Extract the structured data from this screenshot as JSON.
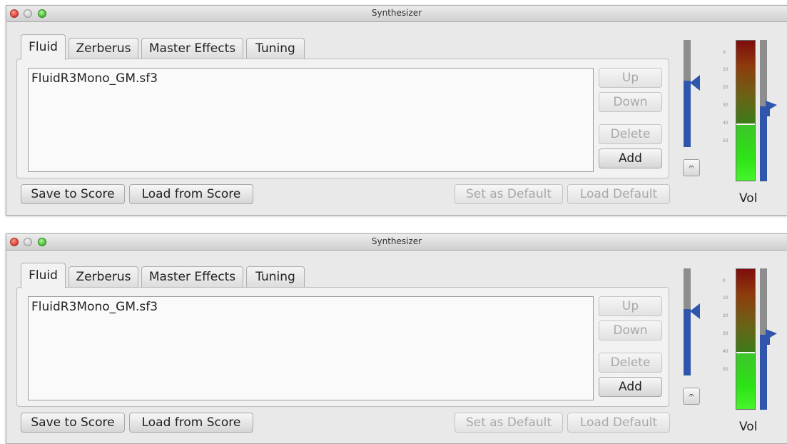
{
  "windows": [
    {
      "title": "Synthesizer",
      "tabs": [
        "Fluid",
        "Zerberus",
        "Master Effects",
        "Tuning"
      ],
      "active_tab": "Fluid",
      "soundfonts": [
        "FluidR3Mono_GM.sf3"
      ],
      "side_buttons": {
        "up": "Up",
        "down": "Down",
        "delete": "Delete",
        "add": "Add"
      },
      "bottom_buttons": {
        "save_to_score": "Save to Score",
        "load_from_score": "Load from Score",
        "set_as_default": "Set as Default",
        "load_default": "Load Default"
      },
      "gain_level": 0.62,
      "meter_level": 0.4,
      "volume_level": 0.53,
      "meter_scale": [
        "0",
        "10",
        "20",
        "30",
        "40",
        "50"
      ],
      "vol_label": "Vol"
    },
    {
      "title": "Synthesizer",
      "tabs": [
        "Fluid",
        "Zerberus",
        "Master Effects",
        "Tuning"
      ],
      "active_tab": "Fluid",
      "soundfonts": [
        "FluidR3Mono_GM.sf3"
      ],
      "side_buttons": {
        "up": "Up",
        "down": "Down",
        "delete": "Delete",
        "add": "Add"
      },
      "bottom_buttons": {
        "save_to_score": "Save to Score",
        "load_from_score": "Load from Score",
        "set_as_default": "Set as Default",
        "load_default": "Load Default"
      },
      "gain_level": 0.62,
      "meter_level": 0.4,
      "volume_level": 0.53,
      "meter_scale": [
        "0",
        "10",
        "20",
        "30",
        "40",
        "50"
      ],
      "vol_label": "Vol"
    }
  ],
  "icons": {
    "window_controls": [
      "close-icon",
      "minimize-icon",
      "zoom-icon"
    ],
    "metronome": "metronome-icon"
  },
  "colors": {
    "slider_fill": "#2f55ad",
    "meter_green": "#2de316",
    "meter_red": "#7d0d0d"
  }
}
